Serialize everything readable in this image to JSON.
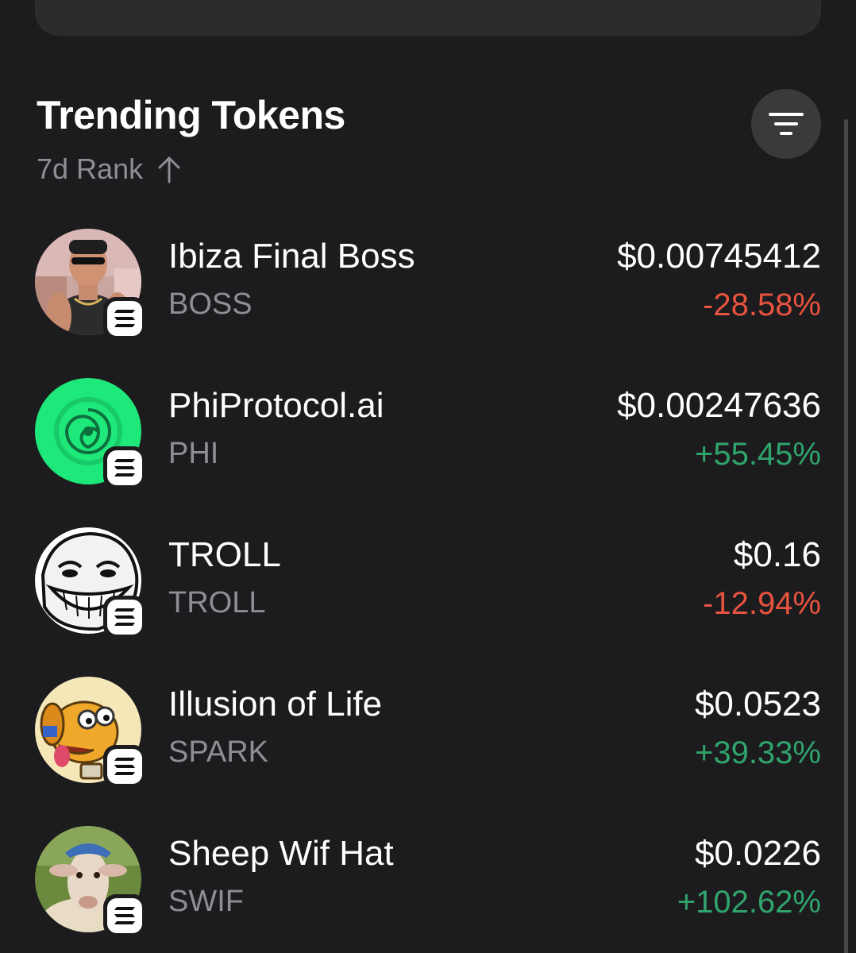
{
  "section": {
    "title": "Trending Tokens",
    "sort_label": "7d Rank",
    "sort_direction_icon": "arrow-up-icon",
    "filter_icon": "filter-icon"
  },
  "colors": {
    "background": "#1c1c1e",
    "negative": "#e8533f",
    "positive": "#30a46c",
    "muted": "#8e8e93"
  },
  "tokens": [
    {
      "name": "Ibiza Final Boss",
      "symbol": "BOSS",
      "price": "$0.00745412",
      "change": "-28.58%",
      "trend": "neg",
      "avatar": "person-avatar",
      "chain_icon": "solana-icon"
    },
    {
      "name": "PhiProtocol.ai",
      "symbol": "PHI",
      "price": "$0.00247636",
      "change": "+55.45%",
      "trend": "pos",
      "avatar": "spiral-logo-avatar",
      "chain_icon": "solana-icon"
    },
    {
      "name": "TROLL",
      "symbol": "TROLL",
      "price": "$0.16",
      "change": "-12.94%",
      "trend": "neg",
      "avatar": "trollface-avatar",
      "chain_icon": "solana-icon"
    },
    {
      "name": "Illusion of Life",
      "symbol": "SPARK",
      "price": "$0.0523",
      "change": "+39.33%",
      "trend": "pos",
      "avatar": "cartoon-dog-avatar",
      "chain_icon": "solana-icon"
    },
    {
      "name": "Sheep Wif Hat",
      "symbol": "SWIF",
      "price": "$0.0226",
      "change": "+102.62%",
      "trend": "pos",
      "avatar": "sheep-avatar",
      "chain_icon": "solana-icon"
    }
  ]
}
